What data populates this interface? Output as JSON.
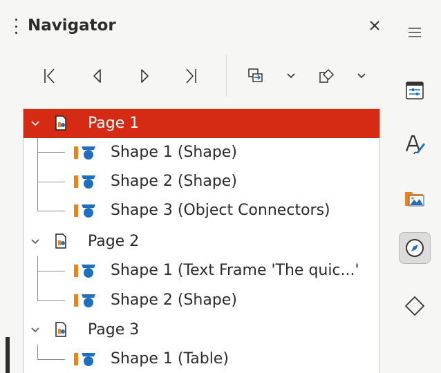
{
  "panel": {
    "title": "Navigator",
    "close_label": "×"
  },
  "toolbar": {
    "buttons": [
      {
        "name": "first-page-button",
        "icon": "first-page-icon"
      },
      {
        "name": "previous-page-button",
        "icon": "previous-page-icon"
      },
      {
        "name": "next-page-button",
        "icon": "next-page-icon"
      },
      {
        "name": "last-page-button",
        "icon": "last-page-icon"
      },
      {
        "name": "drag-mode-button",
        "icon": "drag-mode-icon"
      },
      {
        "name": "drag-mode-dropdown",
        "icon": "chevron-down-icon"
      },
      {
        "name": "shapes-button",
        "icon": "shapes-icon"
      },
      {
        "name": "shapes-dropdown",
        "icon": "chevron-down-icon"
      }
    ]
  },
  "tree": {
    "pages": [
      {
        "label": "Page 1",
        "expanded": true,
        "selected": true,
        "shapes": [
          {
            "label": "Shape 1 (Shape)"
          },
          {
            "label": "Shape 2 (Shape)"
          },
          {
            "label": "Shape 3 (Object Connectors)"
          }
        ]
      },
      {
        "label": "Page 2",
        "expanded": true,
        "selected": false,
        "shapes": [
          {
            "label": "Shape 1 (Text Frame 'The quic...'"
          },
          {
            "label": "Shape 2 (Shape)"
          }
        ]
      },
      {
        "label": "Page 3",
        "expanded": true,
        "selected": false,
        "shapes": [
          {
            "label": "Shape 1 (Table)"
          }
        ]
      }
    ]
  },
  "sidebar": {
    "items": [
      {
        "name": "properties",
        "icon": "properties-icon",
        "active": false
      },
      {
        "name": "styles",
        "icon": "styles-icon",
        "active": false
      },
      {
        "name": "gallery",
        "icon": "gallery-icon",
        "active": false
      },
      {
        "name": "navigator",
        "icon": "navigator-compass-icon",
        "active": true
      },
      {
        "name": "shapes",
        "icon": "diamond-icon",
        "active": false
      }
    ]
  },
  "colors": {
    "selection": "#d52b14",
    "background": "#f6f6f5",
    "shape_orange": "#e9841d",
    "shape_blue": "#1f6fc0"
  }
}
